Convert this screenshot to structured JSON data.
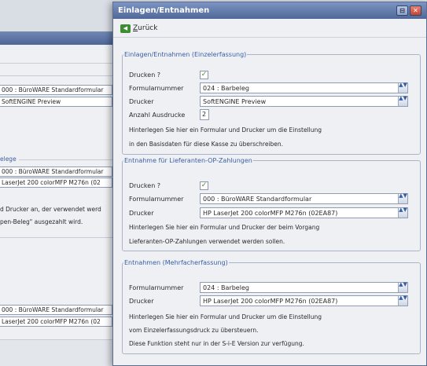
{
  "background_window": {
    "field1": "000 : BüroWARE Standardformular",
    "field2": "SoftENGINE Preview",
    "section": "elege",
    "field3": "000 : BüroWARE Standardformular",
    "field4": "LaserJet 200 colorMFP M276n (02",
    "hint1": "d Drucker an, der verwendet werd",
    "hint2": "pen-Beleg\" ausgezahlt wird.",
    "field5": "000 : BüroWARE Standardformular",
    "field6": "LaserJet 200 colorMFP M276n (02"
  },
  "window": {
    "title": "Einlagen/Entnahmen",
    "minimize_glyph": "⊟",
    "close_glyph": "✕"
  },
  "toolbar": {
    "back_label": "Zurück"
  },
  "group_einlagen": {
    "legend": "Einlagen/Entnahmen (Einzelerfassung)",
    "print_label": "Drucken ?",
    "print_checked": true,
    "form_label": "Formularnummer",
    "form_value": "024 : Barbeleg",
    "printer_label": "Drucker",
    "printer_value": "SoftENGINE Preview",
    "copies_label": "Anzahl Ausdrucke",
    "copies_value": "2",
    "hint_line1": "Hinterlegen Sie hier ein Formular und Drucker um die Einstellung",
    "hint_line2": "in den Basisdaten für diese Kasse zu überschreiben."
  },
  "group_lieferanten": {
    "legend": "Entnahme für Lieferanten-OP-Zahlungen",
    "print_label": "Drucken ?",
    "print_checked": true,
    "form_label": "Formularnummer",
    "form_value": "000 : BüroWARE Standardformular",
    "printer_label": "Drucker",
    "printer_value": "HP LaserJet 200 colorMFP M276n (02EA87)",
    "hint_line1": "Hinterlegen Sie hier ein Formular und Drucker der beim Vorgang",
    "hint_line2": "Lieferanten-OP-Zahlungen verwendet werden sollen."
  },
  "group_mehrfach": {
    "legend": "Entnahmen (Mehrfacherfassung)",
    "form_label": "Formularnummer",
    "form_value": "024 : Barbeleg",
    "printer_label": "Drucker",
    "printer_value": "HP LaserJet 200 colorMFP M276n (02EA87)",
    "hint_line1": "Hinterlegen Sie hier ein Formular und Drucker um die Einstellung",
    "hint_line2": "vom Einzelerfassungsdruck zu übersteuern.",
    "hint_line3": "Diese Funktion steht nur in der S-i-E Version zur verfügung."
  },
  "icons": {
    "check": "✓",
    "dropdown": "▲▼"
  },
  "colors": {
    "titlebar": "#5a73a4",
    "legend_text": "#3a5fa4",
    "checkmark": "#4a8c2e"
  }
}
